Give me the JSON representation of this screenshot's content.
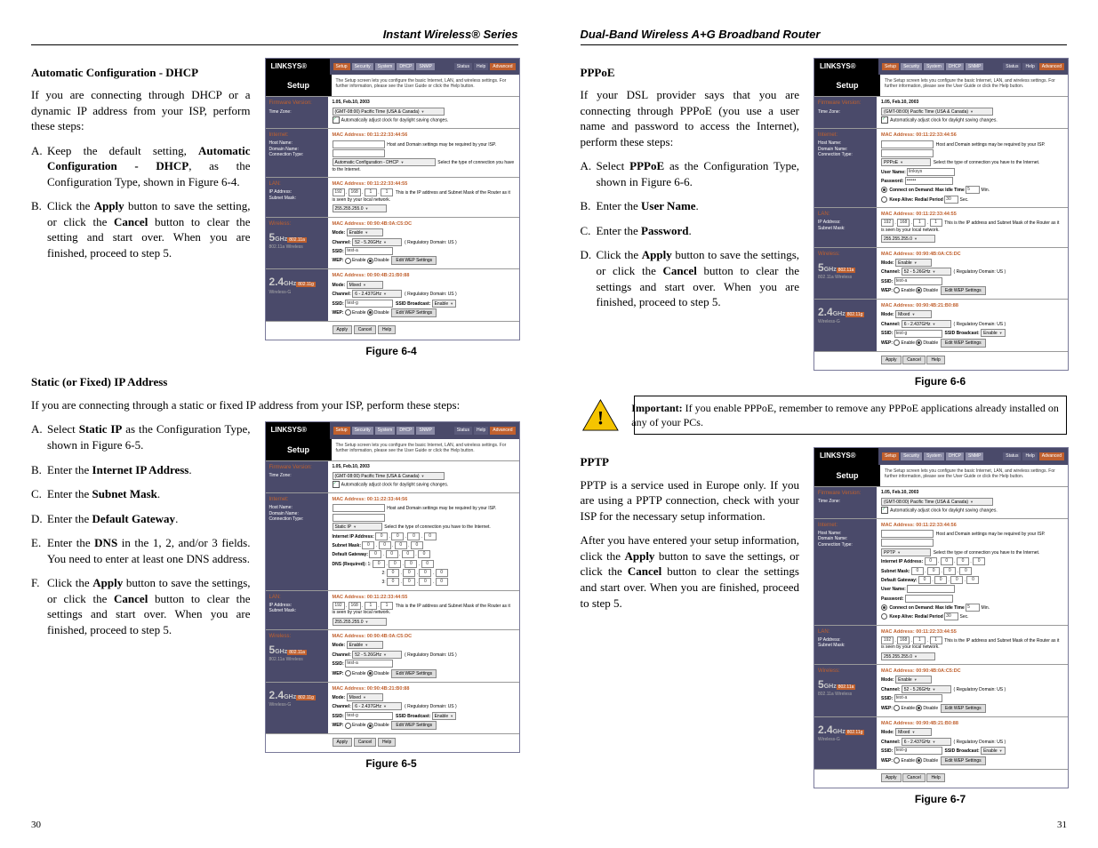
{
  "headers": {
    "left": "Instant Wireless® Series",
    "right": "Dual-Band Wireless A+G Broadband Router"
  },
  "page_numbers": {
    "left": "30",
    "right": "31"
  },
  "left_page": {
    "dhcp": {
      "title": "Automatic Configuration - DHCP",
      "intro": "If you are connecting through DHCP or a dynamic IP address from your ISP, perform these steps:",
      "steps": [
        {
          "m": "A.",
          "html": "Keep the default setting, <b>Automatic Configuration - DHCP</b>, as the Configuration Type, shown in Figure 6-4."
        },
        {
          "m": "B.",
          "html": "Click the <b>Apply</b> button to save the setting, or click the <b>Cancel</b> button to clear the setting and start over. When you are finished, proceed to step 5."
        }
      ],
      "figure": "Figure 6-4"
    },
    "static": {
      "title": "Static (or Fixed) IP Address",
      "intro": "If you are connecting through a static or fixed IP address from your ISP, perform these steps:",
      "steps": [
        {
          "m": "A.",
          "html": "Select <b>Static IP</b> as the Configuration Type, shown in Figure 6-5."
        },
        {
          "m": "B.",
          "html": "Enter the <b>Internet IP Address</b>."
        },
        {
          "m": "C.",
          "html": "Enter the <b>Subnet Mask</b>."
        },
        {
          "m": "D.",
          "html": "Enter the <b>Default Gateway</b>."
        },
        {
          "m": "E.",
          "html": "Enter the <b>DNS</b> in the 1, 2, and/or 3 fields. You need to enter at least one DNS address."
        },
        {
          "m": "F.",
          "html": "Click the <b>Apply</b> button to save the settings, or click the <b>Cancel</b> button to clear the settings and start over. When you are finished, proceed to step 5."
        }
      ],
      "figure": "Figure 6-5"
    }
  },
  "right_page": {
    "pppoe": {
      "title": "PPPoE",
      "intro": "If your DSL provider says that you are connecting through PPPoE (you use a user name and password to access the Internet), perform these steps:",
      "steps": [
        {
          "m": "A.",
          "html": "Select <b>PPPoE</b> as the Configuration Type, shown in Figure 6-6."
        },
        {
          "m": "B.",
          "html": "Enter the <b>User Name</b>."
        },
        {
          "m": "C.",
          "html": "Enter the <b>Password</b>."
        },
        {
          "m": "D.",
          "html": "Click the <b>Apply</b> button to save the settings, or click the <b>Cancel</b> button to clear the settings and start over. When you are finished, proceed to step 5."
        }
      ],
      "figure": "Figure 6-6",
      "important": "If you enable PPPoE, remember to remove any PPPoE applications already installed on any of your PCs.",
      "important_label": "Important:"
    },
    "pptp": {
      "title": "PPTP",
      "p1": "PPTP is a service used in Europe only. If you are using a PPTP connection, check with your ISP for the necessary setup information.",
      "p2_html": "After you have entered your setup information, click the <b>Apply</b> button to save the settings, or click the <b>Cancel</b> button to clear the settings and start over. When you are finished, proceed to step 5.",
      "figure": "Figure 6-7"
    }
  },
  "router": {
    "brand": "LINKSYS®",
    "tabs": [
      "Setup",
      "Security",
      "System",
      "DHCP",
      "SNMP"
    ],
    "right_tabs": [
      "Status",
      "Help",
      "Advanced"
    ],
    "setup_label": "Setup",
    "setup_desc": "The Setup screen lets you configure the basic Internet, LAN, and wireless settings. For further information, please see the User Guide or click the Help button.",
    "fw_label": "Firmware Version:",
    "fw_value": "1.05, Feb.10, 2003",
    "tz_label": "Time Zone:",
    "tz_value": "(GMT-08:00) Pacific Time (USA & Canada)",
    "tz_check": "Automatically adjust clock for daylight saving changes.",
    "internet_label": "Internet:",
    "mac_internet": "MAC Address: 00:11:22:33:44:56",
    "host_label": "Host Name:",
    "domain_label": "Domain Name:",
    "host_note": "Host and Domain settings may be required by your ISP.",
    "conn_label": "Connection Type:",
    "conn_note": "Select the type of connection you have to the Internet.",
    "conn_dhcp": "Automatic Configuration - DHCP",
    "conn_static": "Static IP",
    "conn_pppoe": "PPPoE",
    "conn_pptp": "PPTP",
    "static_fields": {
      "ip": "Internet IP Address:",
      "mask": "Subnet Mask:",
      "gw": "Default Gateway:",
      "dns": "DNS (Required):"
    },
    "pppoe_fields": {
      "user": "User Name:",
      "pass": "Password:",
      "user_val": "linksys",
      "pass_val": "••••••",
      "cod": "Connect on Demand: Max Idle Time",
      "cod_unit": "Min.",
      "cod_val": "5",
      "ka": "Keep Alive: Redial Period",
      "ka_unit": "Sec.",
      "ka_val": "30"
    },
    "lan_label": "LAN:",
    "mac_lan": "MAC Address: 00:11:22:33:44:55",
    "ip_label": "IP Address:",
    "ip_val": [
      "192",
      "168",
      "1",
      "1"
    ],
    "ip_note": "This is the IP address and Subnet Mask of the Router as it is seen by your local network.",
    "mask_label": "Subnet Mask:",
    "mask_val": "255.255.255.0",
    "wl_label": "Wireless:",
    "mac_5g": "MAC Address: 00:90:4B:0A:C5:DC",
    "mac_24g": "MAC Address: 00:90:4B:21:B0:88",
    "mode_label": "Mode:",
    "mode_enable": "Enable",
    "mode_mixed": "Mixed",
    "chan_label": "Channel:",
    "chan_5": "52 - 5.26GHz",
    "chan_24": "6 - 2.437GHz",
    "reg": "( Regulatory Domain: US )",
    "ssid_label": "SSID:",
    "ssid_a": "test-a",
    "ssid_g": "test-g",
    "bcast_label": "SSID Broadcast:",
    "bcast_val": "Enable",
    "wep_label": "WEP:",
    "enable": "Enable",
    "disable": "Disable",
    "wep_btn": "Edit WEP Settings",
    "btns": {
      "apply": "Apply",
      "cancel": "Cancel",
      "help": "Help"
    },
    "ghz5": "5",
    "ghz5u": "GHz",
    "ghz5s": "802.11a",
    "ghz5b": "802.11a Wireless",
    "ghz24": "2.4",
    "ghz24u": "GHz",
    "ghz24s": "802.11g",
    "ghz24b": "Wireless-G"
  }
}
